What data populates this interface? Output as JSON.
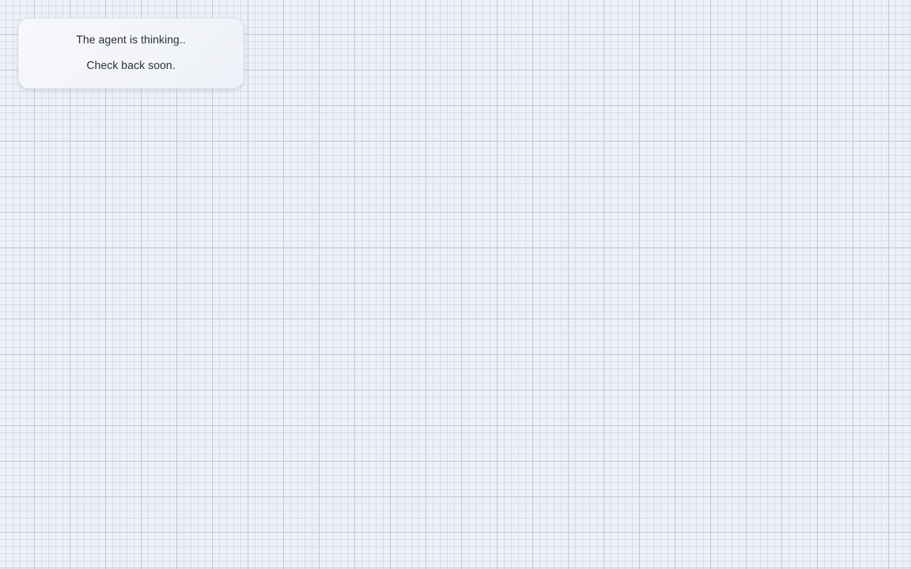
{
  "status_card": {
    "line1": "The agent is thinking..",
    "line2": "Check back soon."
  },
  "colors": {
    "background": "#edf0f7",
    "grid_line": "#b4b8cc",
    "card_background": "#f4f6fa",
    "text": "#2b2f3a"
  }
}
